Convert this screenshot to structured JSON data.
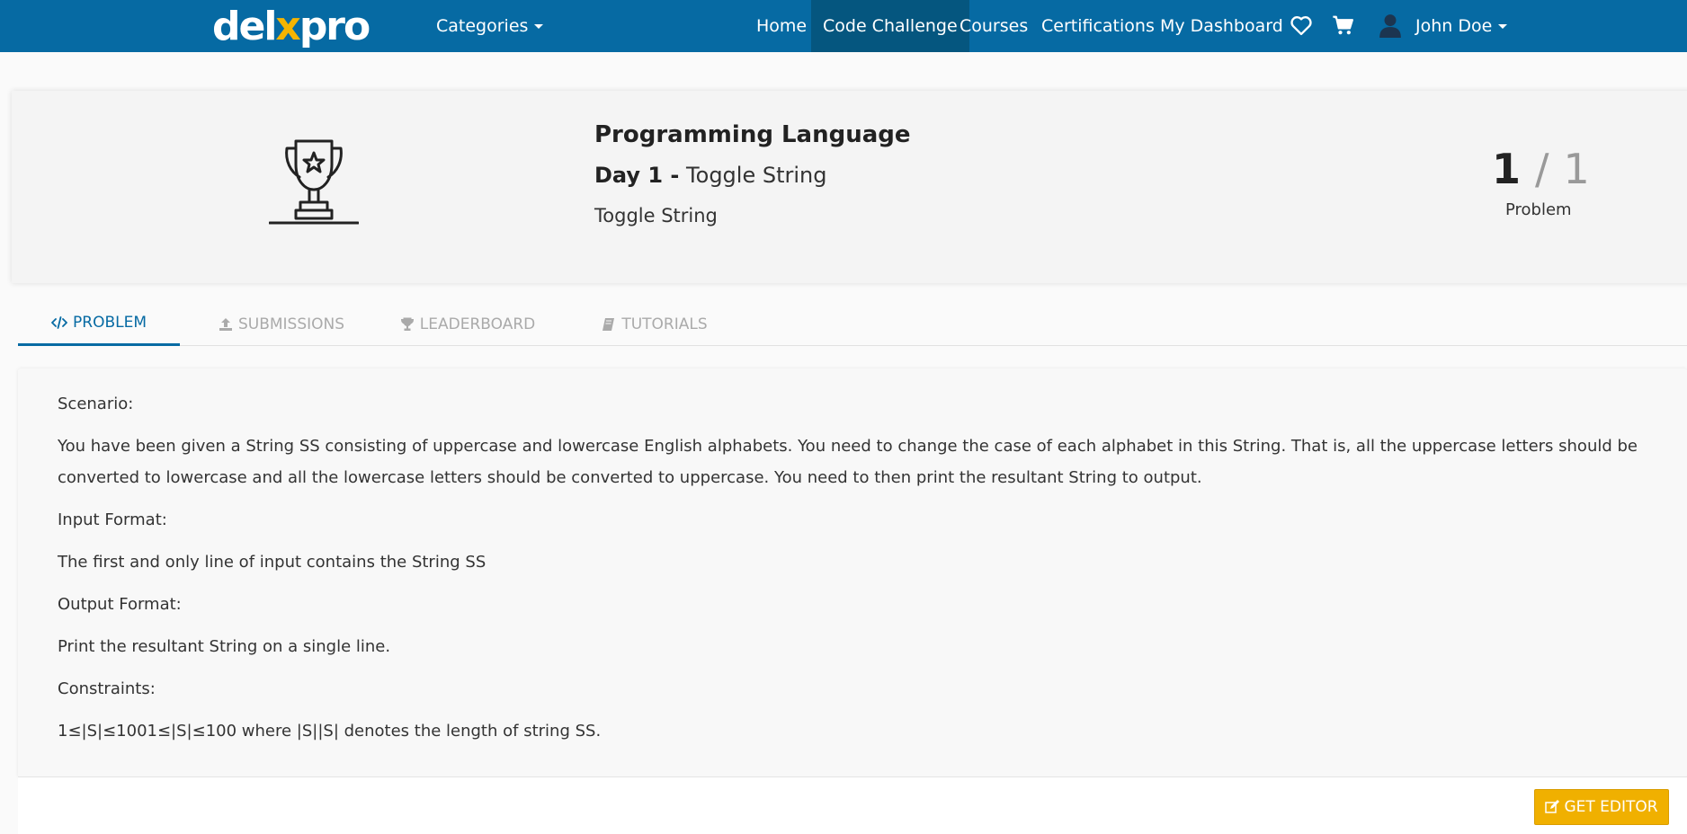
{
  "brand": {
    "logo_text_a": "del",
    "logo_text_x": "x",
    "logo_text_b": "pro"
  },
  "nav": {
    "categories": "Categories",
    "home": "Home",
    "code_challenge": "Code Challenge",
    "courses": "Courses",
    "certifications": "Certifications",
    "dashboard": "My Dashboard",
    "user_name": "John Doe",
    "icons": [
      "heart-icon",
      "cart-icon",
      "user-avatar-icon"
    ]
  },
  "header": {
    "course_title": "Programming Language",
    "day_label": "Day 1 -",
    "day_problem": "Toggle String",
    "problem_subtitle": "Toggle String",
    "current": "1",
    "separator": "/",
    "total": "1",
    "counter_label": "Problem"
  },
  "tabs": [
    {
      "label": "PROBLEM",
      "icon": "code-icon",
      "active": true
    },
    {
      "label": "SUBMISSIONS",
      "icon": "upload-icon",
      "active": false
    },
    {
      "label": "LEADERBOARD",
      "icon": "trophy-icon",
      "active": false
    },
    {
      "label": "TUTORIALS",
      "icon": "book-icon",
      "active": false
    }
  ],
  "problem": {
    "scenario_heading": "Scenario:",
    "scenario_text": "You have been given a String SS consisting of uppercase and lowercase English alphabets. You need to change the case of each alphabet in this String. That is, all the uppercase letters should be converted to lowercase and all the lowercase letters should be converted to uppercase. You need to then print the resultant String to output.",
    "input_heading": "Input Format:",
    "input_text": "The first and only line of input contains the String SS",
    "output_heading": "Output Format:",
    "output_text": "Print the resultant String on a single line.",
    "constraints_heading": "Constraints:",
    "constraints_text": "1≤|S|≤1001≤|S|≤100 where |S||S| denotes the length of string SS."
  },
  "editor_button": {
    "label": "GET EDITOR",
    "icon": "edit-icon"
  },
  "colors": {
    "nav_bg": "#066aa3",
    "nav_active": "#05567f",
    "accent_button": "#f0b000"
  }
}
